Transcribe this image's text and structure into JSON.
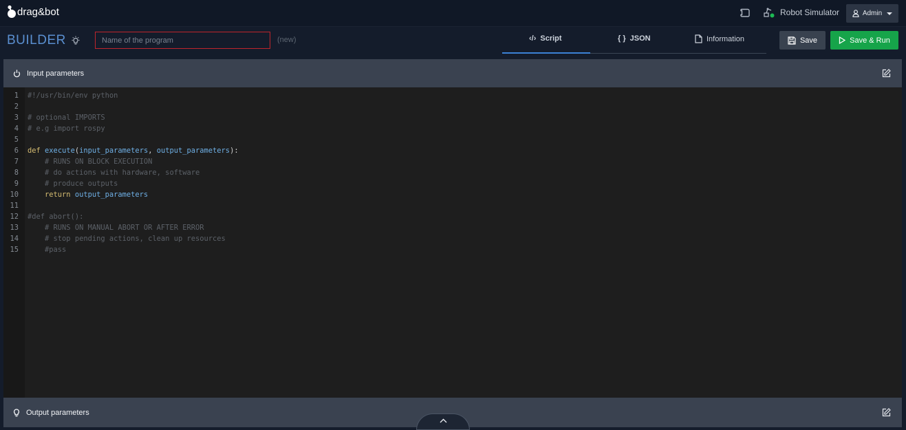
{
  "header": {
    "brand": "drag&bot",
    "robot_simulator_label": "Robot Simulator",
    "user_label": "Admin",
    "icons": [
      "drag-bot-logo-icon",
      "notification-icon",
      "robot-arm-icon",
      "user-icon"
    ]
  },
  "builder": {
    "title": "BUILDER",
    "name_placeholder": "Name of the program",
    "name_value": "",
    "status": "(new)",
    "tabs": [
      {
        "label": "Script",
        "icon": "code-icon",
        "active": true
      },
      {
        "label": "JSON",
        "icon": "braces-icon",
        "active": false
      },
      {
        "label": "Information",
        "icon": "document-icon",
        "active": false
      }
    ],
    "save_label": "Save",
    "save_run_label": "Save & Run"
  },
  "panels": {
    "input_title": "Input parameters",
    "output_title": "Output parameters"
  },
  "code_lines": [
    {
      "n": "1",
      "text": "#!/usr/bin/env python"
    },
    {
      "n": "2",
      "text": ""
    },
    {
      "n": "3",
      "text": "# optional IMPORTS"
    },
    {
      "n": "4",
      "text": "# e.g import rospy"
    },
    {
      "n": "5",
      "text": ""
    },
    {
      "n": "6",
      "kw": "def",
      "fn": "execute",
      "p1": "input_parameters",
      "p2": "output_parameters"
    },
    {
      "n": "7",
      "text": "    # RUNS ON BLOCK EXECUTION"
    },
    {
      "n": "8",
      "text": "    # do actions with hardware, software"
    },
    {
      "n": "9",
      "text": "    # produce outputs"
    },
    {
      "n": "10",
      "kw": "return",
      "value": "output_parameters"
    },
    {
      "n": "11",
      "text": ""
    },
    {
      "n": "12",
      "text": "#def abort():"
    },
    {
      "n": "13",
      "text": "    # RUNS ON MANUAL ABORT OR AFTER ERROR"
    },
    {
      "n": "14",
      "text": "    # stop pending actions, clean up resources"
    },
    {
      "n": "15",
      "text": "    #pass"
    }
  ],
  "colors": {
    "accent_blue": "#3c82d6",
    "run_green": "#16a44a",
    "error_red": "#c0252c",
    "online_dot": "#1db954"
  }
}
